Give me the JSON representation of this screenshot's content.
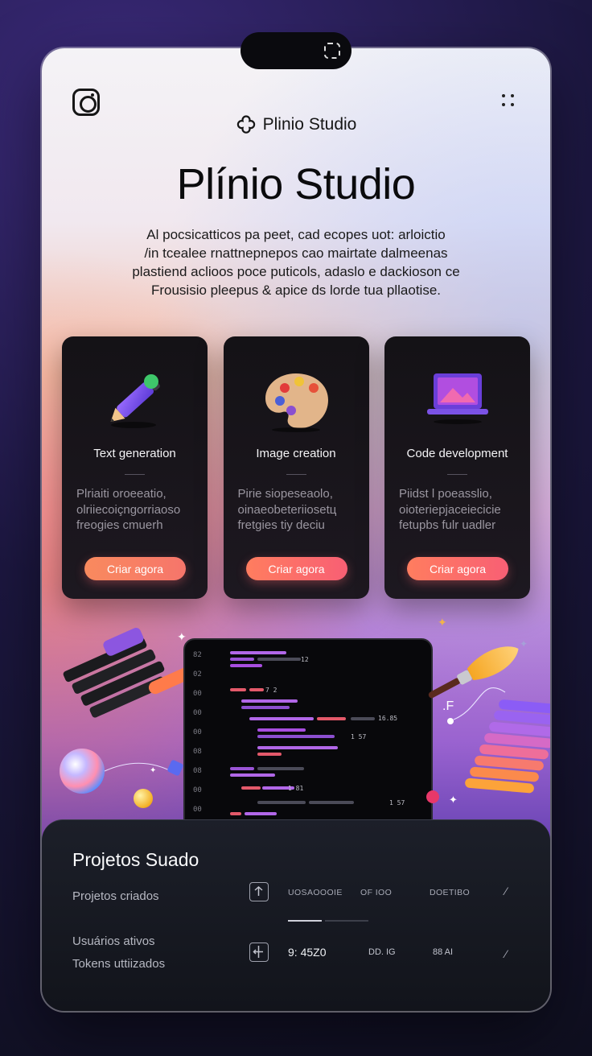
{
  "header": {
    "brand_name": "Plinio Studio",
    "hero_title": "Plínio Studio",
    "hero_description_lines": [
      "Al pocsicatticos pa peet, cad ecopes uot: arloictio",
      "/in tcealee rnattnepnepos cao mairtate  dalmeenas",
      "plastiend acliоos poce puticols, adaslo e dackiosоn ce",
      "Frousisio pleepus & apice ds lorde tua pllаotise."
    ]
  },
  "cards": [
    {
      "title": "Text generation",
      "description_lines": [
        "Plriaiti oroeeatio,",
        "olriiecoiçngorriaoso",
        "freogies cmuerh"
      ],
      "button_label": "Criar agora",
      "icon": "pencil-icon"
    },
    {
      "title": "Image creation",
      "description_lines": [
        "Pirie siopeseaolo,",
        "oinaeobeteriiosetц",
        "fretgies tiy deciu"
      ],
      "button_label": "Criar agora",
      "icon": "palette-icon"
    },
    {
      "title": "Code development",
      "description_lines": [
        "Piidst l poeasslio,",
        "oioteriepjaceiecicie",
        "fetupbs fulr uadler"
      ],
      "button_label": "Criar agora",
      "icon": "laptop-icon"
    }
  ],
  "code_panel": {
    "line_numbers": [
      "82",
      "02",
      "00",
      "00",
      "00",
      "08",
      "08",
      "00",
      "00",
      "00",
      "00"
    ],
    "float_labels": [
      "12",
      "7 2",
      "16.85",
      "1 57",
      "1 81",
      "1 57"
    ]
  },
  "decor_text": ".F",
  "stats": {
    "title": "Projetos Suado",
    "labels": [
      "Projetos criados",
      "Usuários ativos",
      "Tokens uttiizados"
    ],
    "row1": {
      "col_a": "UOSAOOOIE",
      "col_b": "OF IOO",
      "col_c": "DOETIBO"
    },
    "row2": {
      "value": "9: 45Z0",
      "col_b": "DD. IG",
      "col_c": "88 AI"
    }
  },
  "colors": {
    "accent_gradient_start": "#ff7d5f",
    "accent_gradient_end": "#f85f74",
    "card_bg": "#141216",
    "panel_bg": "#1c1f29"
  }
}
